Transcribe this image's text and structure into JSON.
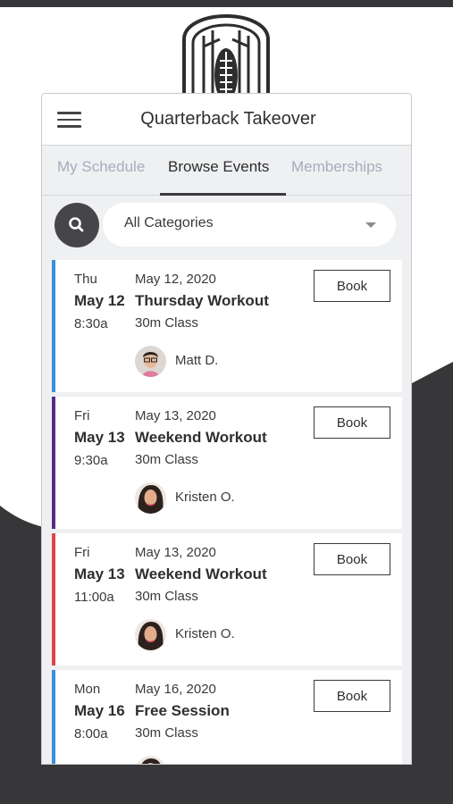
{
  "header": {
    "title": "Quarterback Takeover",
    "menu_icon": "hamburger-menu-icon"
  },
  "tabs": [
    {
      "label": "My Schedule",
      "active": false
    },
    {
      "label": "Browse Events",
      "active": true
    },
    {
      "label": "Memberships",
      "active": false
    }
  ],
  "filter": {
    "search_icon": "search-icon",
    "category": "All Categories"
  },
  "events": [
    {
      "day": "Thu",
      "short_date": "May 12",
      "time": "8:30a",
      "full_date": "May 12, 2020",
      "name": "Thursday Workout",
      "class_type": "30m Class",
      "instructor": "Matt D.",
      "accent": "#3a8fd6",
      "book_label": "Book"
    },
    {
      "day": "Fri",
      "short_date": "May 13",
      "time": "9:30a",
      "full_date": "May 13, 2020",
      "name": "Weekend Workout",
      "class_type": "30m Class",
      "instructor": "Kristen O.",
      "accent": "#5b2a86",
      "book_label": "Book"
    },
    {
      "day": "Fri",
      "short_date": "May 13",
      "time": "11:00a",
      "full_date": "May 13, 2020",
      "name": "Weekend Workout",
      "class_type": "30m Class",
      "instructor": "Kristen O.",
      "accent": "#e0444c",
      "book_label": "Book"
    },
    {
      "day": "Mon",
      "short_date": "May 16",
      "time": "8:00a",
      "full_date": "May 16, 2020",
      "name": "Free Session",
      "class_type": "30m Class",
      "instructor": "",
      "accent": "#3a8fd6",
      "book_label": "Book"
    }
  ],
  "colors": {
    "dark_background": "#373739",
    "card_background": "#eef0f2",
    "inactive_tab": "#a9acbb"
  }
}
